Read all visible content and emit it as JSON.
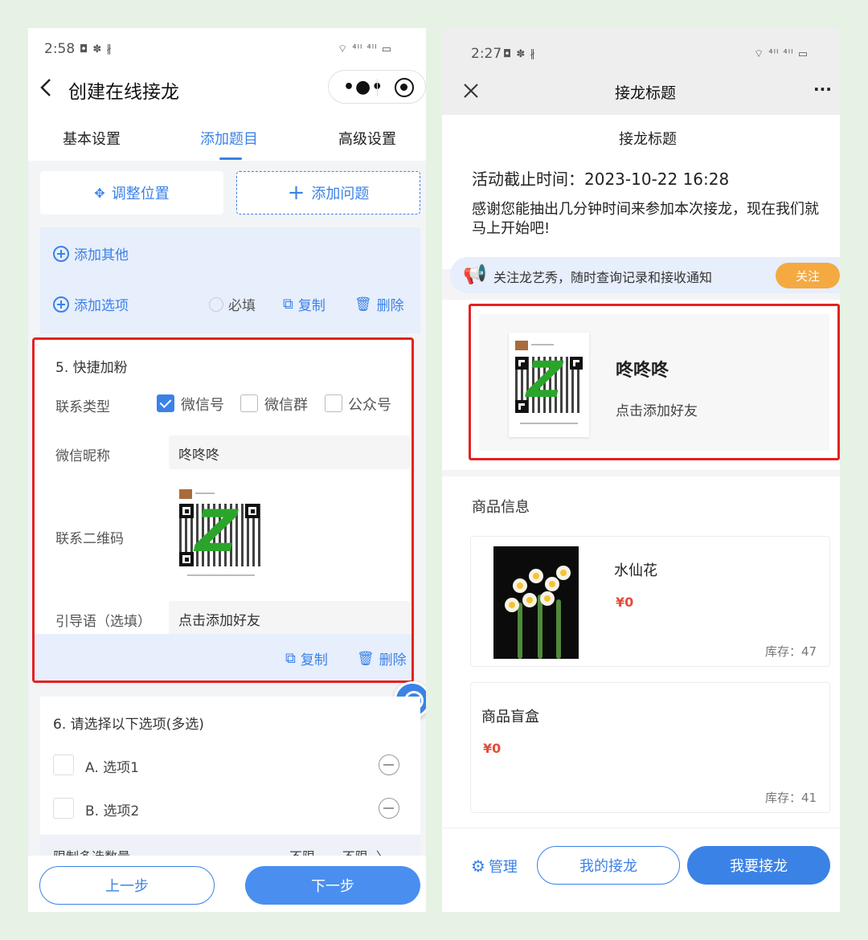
{
  "left": {
    "status": {
      "time": "2:58",
      "icons": "◘ ✽ ∦",
      "right_icons": "⌔ ⁴ᴵᴵ ⁴ᴵᴵ ▭"
    },
    "title": "创建在线接龙",
    "capsule": {
      "more": "•●•"
    },
    "tabs": [
      "基本设置",
      "添加题目",
      "高级设置"
    ],
    "actions": {
      "adjust": "调整位置",
      "add_question": "添加问题"
    },
    "panel": {
      "add_other": "添加其他",
      "add_option": "添加选项",
      "required": "必填",
      "copy": "复制",
      "delete": "删除"
    },
    "q5": {
      "title": "5.  快捷加粉",
      "contact_type_label": "联系类型",
      "options": [
        "微信号",
        "微信群",
        "公众号"
      ],
      "nickname_label": "微信昵称",
      "nickname_value": "咚咚咚",
      "qr_label": "联系二维码",
      "guide_label": "引导语（选填）",
      "guide_value": "点击添加好友",
      "copy": "复制",
      "delete": "删除"
    },
    "q6": {
      "title": "6.  请选择以下选项(多选)",
      "options": [
        "A. 选项1",
        "B. 选项2"
      ],
      "limit_label": "限制多选数量",
      "limit_value": "不限  ~  不限  〉"
    },
    "footer": {
      "prev": "上一步",
      "next": "下一步"
    }
  },
  "right": {
    "status": {
      "time": "2:27",
      "icons": "◘ ✽ ∦",
      "right_icons": "⌔ ⁴ᴵᴵ ⁴ᴵᴵ ▭"
    },
    "nav_title": "接龙标题",
    "more": "···",
    "subtitle": "接龙标题",
    "deadline": "活动截止时间：2023-10-22 16:28",
    "intro": "感谢您能抽出几分钟时间来参加本次接龙，现在我们就马上开始吧!",
    "notice": "关注龙艺秀，随时查询记录和接收通知",
    "follow": "关注",
    "friend": {
      "name": "咚咚咚",
      "hint": "点击添加好友"
    },
    "goods_title": "商品信息",
    "goods": [
      {
        "name": "水仙花",
        "price": "¥0",
        "stock": "库存：47"
      },
      {
        "name": "商品盲盒",
        "price": "¥0",
        "stock": "库存：41"
      }
    ],
    "footer": {
      "manage": "管理",
      "mine": "我的接龙",
      "join": "我要接龙"
    }
  }
}
